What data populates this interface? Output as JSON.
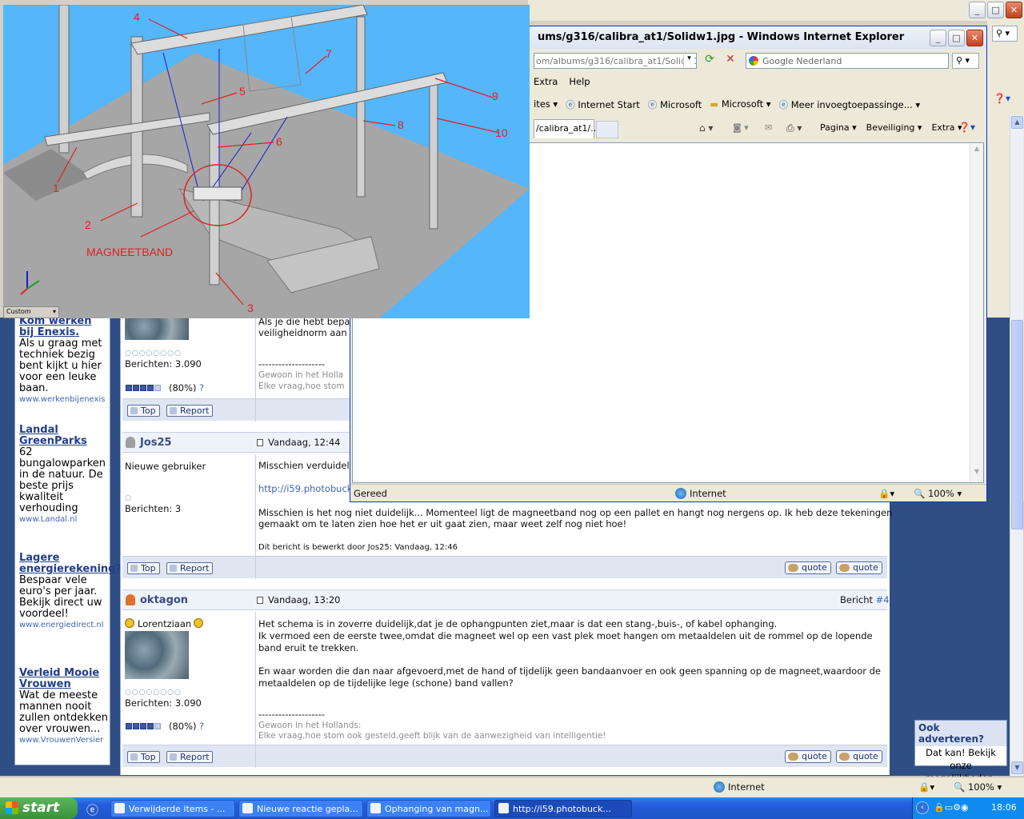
{
  "background_window": {
    "menu_right": "▾",
    "status": {
      "zone": "Internet",
      "zoom": "100%"
    }
  },
  "ie_window": {
    "title": "ums/g316/calibra_at1/Solidw1.jpg - Windows Internet Explorer",
    "address": "om/albums/g316/calibra_at1/Solidw1.jp",
    "search_placeholder": "Google Nederland",
    "menu": [
      "Extra",
      "Help"
    ],
    "favorites": [
      "ites ▾",
      "Internet Start",
      "Microsoft",
      "Microsoft ▾",
      "Meer invoegtoepassinge... ▾"
    ],
    "tab_label": "/calibra_at1/...",
    "commands": [
      "Pagina ▾",
      "Beveiliging ▾",
      "Extra ▾"
    ],
    "status": {
      "left": "Gereed",
      "zone": "Internet",
      "zoom": "100%"
    }
  },
  "image": {
    "labels": [
      "1",
      "2",
      "3",
      "4",
      "5",
      "6",
      "7",
      "8",
      "9",
      "10"
    ],
    "caption": "MAGNEETBAND",
    "combo": "Custom"
  },
  "ads": [
    {
      "title": "Kom werken bij Enexis.",
      "body": "Als u graag met techniek bezig bent kijkt u hier voor een leuke baan.",
      "url": "www.werkenbijenexis"
    },
    {
      "title": "Landal GreenParks",
      "body": "62 bungalowparken in de natuur. De beste prijs kwaliteit verhouding",
      "url": "www.Landal.nl"
    },
    {
      "title": "Lagere energierekening?",
      "body": "Bespaar vele euro's per jaar. Bekijk direct uw voordeel!",
      "url": "www.energiedirect.nl"
    },
    {
      "title": "Verleid Mooie Vrouwen",
      "body": "Wat de meeste mannen nooit zullen ontdekken over vrouwen...",
      "url": "www.VrouwenVersier"
    }
  ],
  "posts": {
    "p1": {
      "posts_count": "Berichten: 3.090",
      "rep": "(80%)",
      "rep_q": "?",
      "text_lines": [
        "Als je die hebt bepa",
        "veiligheidnorm aan"
      ],
      "sig_line": "--------------------",
      "sig1": "Gewoon in het Holla",
      "sig2": "Elke vraag,hoe stom"
    },
    "p2": {
      "user": "Jos25",
      "date": "Vandaag, 12:44",
      "rank": "Nieuwe gebruiker",
      "posts_count": "Berichten: 3",
      "line1": "Misschien verduidel",
      "link": "http://i59.photobuck",
      "body1": "Misschien is het nog niet duidelijk... Momenteel ligt de magneetband nog op een pallet en hangt nog nergens op. Ik heb deze tekeningen",
      "body2": "gemaakt om te laten zien hoe het er uit gaat zien, maar weet zelf nog niet hoe!",
      "edited": "Dit bericht is bewerkt door Jos25: Vandaag, 12:46"
    },
    "p3": {
      "user": "oktagon",
      "date": "Vandaag, 13:20",
      "post_no": "Bericht #4",
      "rank": "Lorentziaan",
      "posts_count": "Berichten: 3.090",
      "rep": "(80%)",
      "rep_q": "?",
      "lines": [
        "Het schema is in zoverre duidelijk,dat je de ophangpunten ziet,maar is dat een stang-,buis-, of kabel ophanging.",
        "Ik vermoed een de eerste twee,omdat die magneet wel op een vast plek moet hangen om metaaldelen uit de rommel op de lopende",
        "band eruit te trekken.",
        "En waar worden die dan naar afgevoerd,met de hand of tijdelijk geen bandaanvoer en ook geen spanning op de magneet,waardoor de",
        "metaaldelen op de tijdelijke lege (schone) band vallen?"
      ],
      "sig_line": "--------------------",
      "sig1": "Gewoon in het Hollands:",
      "sig2": "Elke vraag,hoe stom ook gesteld,geeft blijk van de aanwezigheid van intelligentie!"
    },
    "buttons": {
      "top": "Top",
      "report": "Report",
      "quote": "quote"
    }
  },
  "advert_box": {
    "title": "Ook adverteren?",
    "body": "Dat kan! Bekijk onze mogelijkheden."
  },
  "taskbar": {
    "start": "start",
    "tasks": [
      "Verwijderde items - ...",
      "Nieuwe reactie gepla...",
      "Ophanging van magn...",
      "http://i59.photobuck..."
    ],
    "clock": "18:06"
  }
}
